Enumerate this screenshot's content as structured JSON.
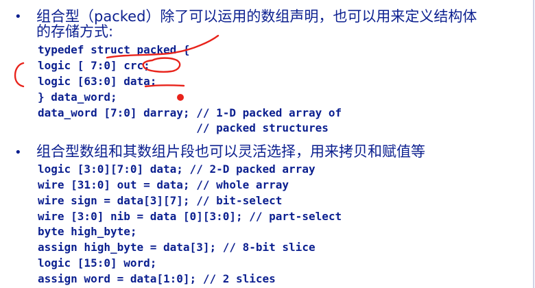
{
  "bullets": [
    {
      "marker": "•",
      "text_line1": "组合型（packed）除了可以运用的数组声明，也可以用来定义结构体",
      "text_line2": "的存储方式:",
      "code": [
        "typedef struct packed {",
        "logic [ 7:0] crc;",
        "logic [63:0] data;",
        "} data_word;",
        "data_word [7:0] darray; // 1-D packed array of",
        "                        // packed structures"
      ]
    },
    {
      "marker": "•",
      "text_line1": "组合型数组和其数组片段也可以灵活选择，用来拷贝和赋值等",
      "code": [
        "logic [3:0][7:0] data; // 2-D packed array",
        "wire [31:0] out = data; // whole array",
        "wire sign = data[3][7]; // bit-select",
        "wire [3:0] nib = data [0][3:0]; // part-select",
        "byte high_byte;",
        "assign high_byte = data[3]; // 8-bit slice",
        "logic [15:0] word;",
        "assign word = data[1:0]; // 2 slices"
      ]
    }
  ],
  "colors": {
    "text": "#0b1f8f",
    "annotation": "#e8231b",
    "background": "#ffffff"
  }
}
